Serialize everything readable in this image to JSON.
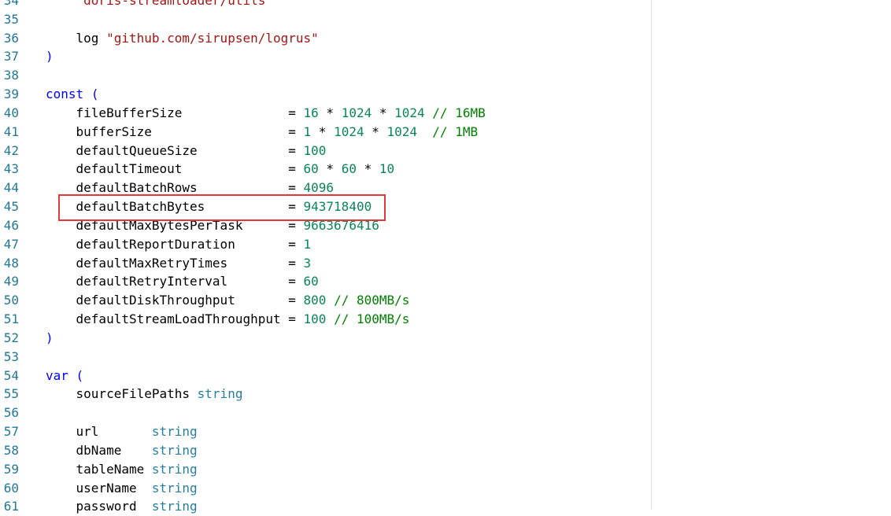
{
  "editor": {
    "colors": {
      "line_number": "#237893",
      "keyword": "#0000ff",
      "string": "#a31515",
      "number": "#098658",
      "type": "#267f99",
      "comment": "#008000",
      "plain": "#000000",
      "highlight_box": "#e03b3b",
      "ruler": "#dcdcdc"
    },
    "highlighted_line": "45",
    "lines": [
      {
        "num": "34",
        "tokens": [
          {
            "t": "    "
          },
          {
            "t": "\"doris-streamloader/utils\"",
            "c": "str"
          }
        ]
      },
      {
        "num": "35",
        "tokens": []
      },
      {
        "num": "36",
        "tokens": [
          {
            "t": "    log "
          },
          {
            "t": "\"github.com/sirupsen/logrus\"",
            "c": "str"
          }
        ]
      },
      {
        "num": "37",
        "tokens": [
          {
            "t": ")",
            "c": "kw"
          }
        ]
      },
      {
        "num": "38",
        "tokens": []
      },
      {
        "num": "39",
        "tokens": [
          {
            "t": "const",
            "c": "kw"
          },
          {
            "t": " "
          },
          {
            "t": "(",
            "c": "kw"
          }
        ]
      },
      {
        "num": "40",
        "tokens": [
          {
            "t": "    fileBufferSize              = "
          },
          {
            "t": "16",
            "c": "num"
          },
          {
            "t": " * "
          },
          {
            "t": "1024",
            "c": "num"
          },
          {
            "t": " * "
          },
          {
            "t": "1024",
            "c": "num"
          },
          {
            "t": " "
          },
          {
            "t": "// 16MB",
            "c": "cmt"
          }
        ]
      },
      {
        "num": "41",
        "tokens": [
          {
            "t": "    bufferSize                  = "
          },
          {
            "t": "1",
            "c": "num"
          },
          {
            "t": " * "
          },
          {
            "t": "1024",
            "c": "num"
          },
          {
            "t": " * "
          },
          {
            "t": "1024",
            "c": "num"
          },
          {
            "t": "  "
          },
          {
            "t": "// 1MB",
            "c": "cmt"
          }
        ]
      },
      {
        "num": "42",
        "tokens": [
          {
            "t": "    defaultQueueSize            = "
          },
          {
            "t": "100",
            "c": "num"
          }
        ]
      },
      {
        "num": "43",
        "tokens": [
          {
            "t": "    defaultTimeout              = "
          },
          {
            "t": "60",
            "c": "num"
          },
          {
            "t": " * "
          },
          {
            "t": "60",
            "c": "num"
          },
          {
            "t": " * "
          },
          {
            "t": "10",
            "c": "num"
          }
        ]
      },
      {
        "num": "44",
        "tokens": [
          {
            "t": "    defaultBatchRows            = "
          },
          {
            "t": "4096",
            "c": "num"
          }
        ]
      },
      {
        "num": "45",
        "tokens": [
          {
            "t": "    defaultBatchBytes           = "
          },
          {
            "t": "943718400",
            "c": "num"
          }
        ]
      },
      {
        "num": "46",
        "tokens": [
          {
            "t": "    defaultMaxBytesPerTask      = "
          },
          {
            "t": "9663676416",
            "c": "num"
          }
        ]
      },
      {
        "num": "47",
        "tokens": [
          {
            "t": "    defaultReportDuration       = "
          },
          {
            "t": "1",
            "c": "num"
          }
        ]
      },
      {
        "num": "48",
        "tokens": [
          {
            "t": "    defaultMaxRetryTimes        = "
          },
          {
            "t": "3",
            "c": "num"
          }
        ]
      },
      {
        "num": "49",
        "tokens": [
          {
            "t": "    defaultRetryInterval        = "
          },
          {
            "t": "60",
            "c": "num"
          }
        ]
      },
      {
        "num": "50",
        "tokens": [
          {
            "t": "    defaultDiskThroughput       = "
          },
          {
            "t": "800",
            "c": "num"
          },
          {
            "t": " "
          },
          {
            "t": "// 800MB/s",
            "c": "cmt"
          }
        ]
      },
      {
        "num": "51",
        "tokens": [
          {
            "t": "    defaultStreamLoadThroughput = "
          },
          {
            "t": "100",
            "c": "num"
          },
          {
            "t": " "
          },
          {
            "t": "// 100MB/s",
            "c": "cmt"
          }
        ]
      },
      {
        "num": "52",
        "tokens": [
          {
            "t": ")",
            "c": "kw"
          }
        ]
      },
      {
        "num": "53",
        "tokens": []
      },
      {
        "num": "54",
        "tokens": [
          {
            "t": "var",
            "c": "kw"
          },
          {
            "t": " "
          },
          {
            "t": "(",
            "c": "kw"
          }
        ]
      },
      {
        "num": "55",
        "tokens": [
          {
            "t": "    sourceFilePaths "
          },
          {
            "t": "string",
            "c": "type"
          }
        ]
      },
      {
        "num": "56",
        "tokens": []
      },
      {
        "num": "57",
        "tokens": [
          {
            "t": "    url       "
          },
          {
            "t": "string",
            "c": "type"
          }
        ]
      },
      {
        "num": "58",
        "tokens": [
          {
            "t": "    dbName    "
          },
          {
            "t": "string",
            "c": "type"
          }
        ]
      },
      {
        "num": "59",
        "tokens": [
          {
            "t": "    tableName "
          },
          {
            "t": "string",
            "c": "type"
          }
        ]
      },
      {
        "num": "60",
        "tokens": [
          {
            "t": "    userName  "
          },
          {
            "t": "string",
            "c": "type"
          }
        ]
      },
      {
        "num": "61",
        "tokens": [
          {
            "t": "    password  "
          },
          {
            "t": "string",
            "c": "type"
          }
        ]
      }
    ]
  }
}
